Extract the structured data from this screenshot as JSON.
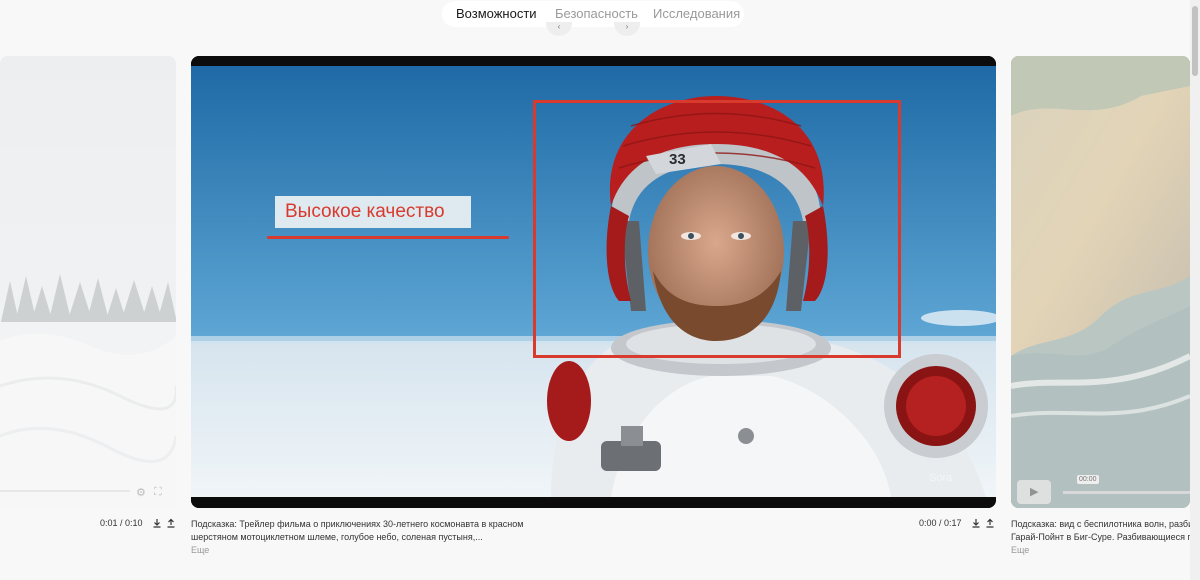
{
  "nav": {
    "tabs": [
      {
        "label": "Возможности",
        "active": true
      },
      {
        "label": "Безопасность",
        "active": false
      },
      {
        "label": "Исследования",
        "active": false
      }
    ]
  },
  "videos": [
    {
      "id": "left",
      "time": "0:01 / 0:10"
    },
    {
      "id": "main",
      "overlay_label": "Высокое качество",
      "helmet_number": "33",
      "time": "0:00 / 0:17",
      "caption_line1": "Подсказка: Трейлер фильма о приключениях 30-летнего космонавта в красном",
      "caption_line2": "шерстяном мотоциклетном шлеме, голубое небо, соленая пустыня,...",
      "more": "Еще"
    },
    {
      "id": "right",
      "scrub_time": "00:00",
      "caption_line1": "Подсказка: вид с беспилотника волн, разбив",
      "caption_line2": "Гарай-Пойнт в Биг-Суре. Разбивающиеся го",
      "more": "Еще"
    }
  ],
  "colors": {
    "highlight_red": "#d93a2e",
    "sky_blue": "#3b86bd",
    "helmet_red": "#b81e1e"
  },
  "icons": [
    "download-icon",
    "share-icon",
    "play-icon",
    "gear-icon",
    "fullscreen-icon"
  ]
}
